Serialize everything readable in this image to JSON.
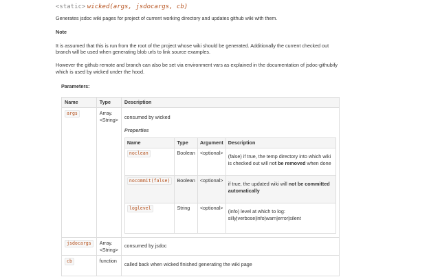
{
  "signature": {
    "tag": "<static>",
    "name": "wicked(args, jsdocargs, cb)"
  },
  "summary": "Generates jsdoc wiki pages for project of current working directory and updates github wiki with them.",
  "note_heading": "Note",
  "note_paragraph": "It is assumed that this is run from the root of the project whose wiki should be generated. Additionally the current checked out branch will be used when generating blob urls to link source examples.",
  "env_paragraph": "However the github remote and branch can also be set via environment vars as explained in the documentation of jsdoc-githubify which is used by wicked under the hood.",
  "parameters_heading": "Parameters:",
  "params_table": {
    "headers": [
      "Name",
      "Type",
      "Description"
    ],
    "rows": [
      {
        "name": "args",
        "type_line1": "Array.",
        "type_line2": "<String>",
        "description": "consumed by wicked",
        "properties_heading": "Properties",
        "properties": {
          "headers": [
            "Name",
            "Type",
            "Argument",
            "Description"
          ],
          "rows": [
            {
              "name": "noclean",
              "type": "Boolean",
              "argument": "<optional>",
              "desc_pre": "(false) if true, the temp directory into which wiki is checked out will no",
              "desc_bold": "t be removed",
              "desc_post": " when done"
            },
            {
              "name": "nocommit(false)",
              "type": "Boolean",
              "argument": "<optional>",
              "desc_pre": "if true, the updated wiki will ",
              "desc_bold": "not be committed automatically",
              "desc_post": ""
            },
            {
              "name": "loglevel",
              "type": "String",
              "argument": "<optional>",
              "desc_line1": "(info) level at which to log:",
              "desc_line2": "silly|verbose|info|warn|error|silent"
            }
          ]
        }
      },
      {
        "name": "jsdocargs",
        "type_line1": "Array.",
        "type_line2": "<String>",
        "description": "consumed by jsdoc"
      },
      {
        "name": "cb",
        "type_line1": "function",
        "description": "called back when wicked finished generating the wiki page"
      }
    ]
  }
}
